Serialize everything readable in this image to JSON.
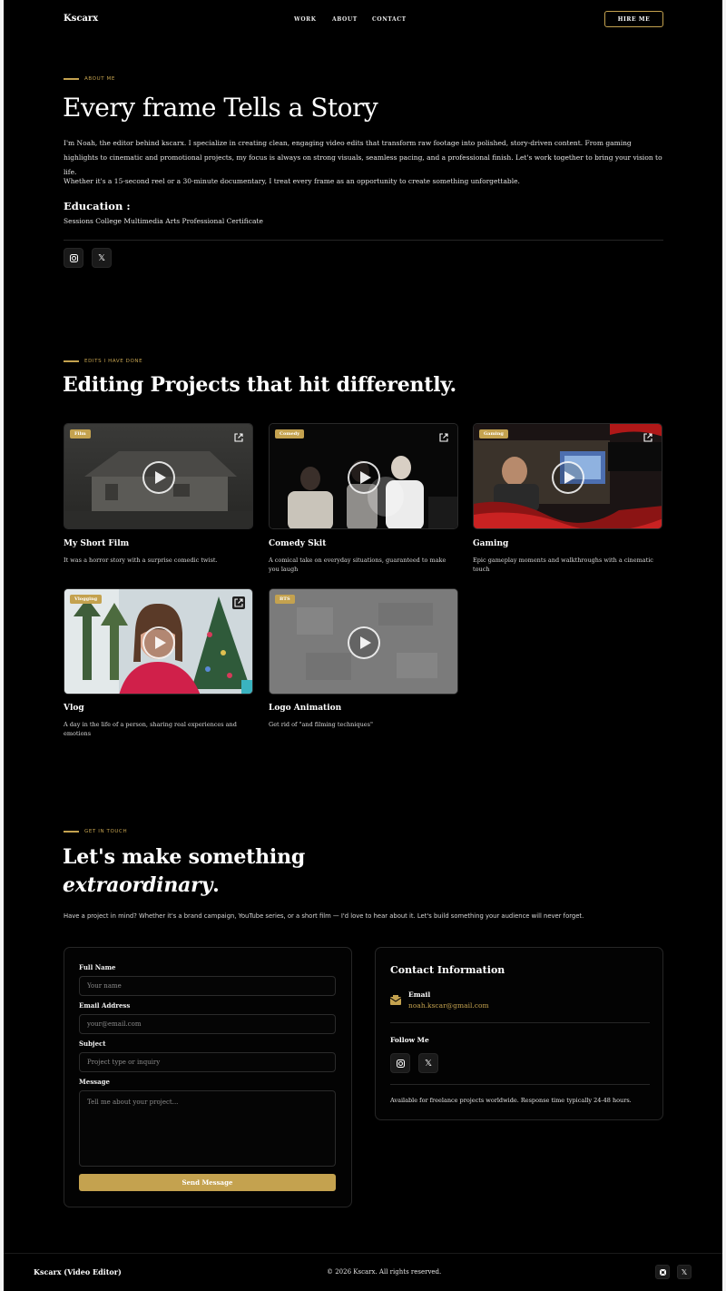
{
  "nav": {
    "logo": "Kscarx",
    "links": [
      "WORK",
      "ABOUT",
      "CONTACT"
    ],
    "cta": "HIRE ME"
  },
  "about": {
    "eyebrow": "ABOUT ME",
    "title": "Every frame Tells a Story",
    "para1": "I'm Noah, the editor behind kscarx. I specialize in creating clean, engaging video edits that transform raw footage into polished, story-driven content. From gaming highlights to cinematic and promotional projects, my focus is always on strong visuals, seamless pacing, and a professional finish. Let's work together to bring your vision to life.",
    "para2": "Whether it's a 15-second reel or a 30-minute documentary, I treat every frame as an opportunity to create something unforgettable.",
    "education_heading": "Education :",
    "education_value": "Sessions College Multimedia Arts Professional Certificate",
    "social": [
      "instagram-icon",
      "x-icon"
    ]
  },
  "projects": {
    "eyebrow": "EDITS I HAVE DONE",
    "title": "Editing Projects that hit differently.",
    "items": [
      {
        "tag": "Film",
        "title": "My Short Film",
        "desc": "It was a horror story with a surprise comedic twist."
      },
      {
        "tag": "Comedy",
        "title": "Comedy Skit",
        "desc": "A comical take on everyday situations, guaranteed to make you laugh"
      },
      {
        "tag": "Gaming",
        "title": "Gaming",
        "desc": "Epic gameplay moments and walkthroughs with a cinematic touch"
      },
      {
        "tag": "Vlogging",
        "title": "Vlog",
        "desc": "A day in the life of a person, sharing real experiences and emotions"
      },
      {
        "tag": "BTS",
        "title": "Logo Animation",
        "desc": "Get rid of \"and filming techniques\""
      }
    ]
  },
  "contact": {
    "eyebrow": "GET IN TOUCH",
    "title_line1": "Let's make something",
    "title_line2_em": "extraordinary",
    "title_line2_dot": ".",
    "intro": "Have a project in mind? Whether it's a brand campaign, YouTube series, or a short film — I'd love to hear about it. Let's build something your audience will never forget.",
    "form": {
      "name_label": "Full Name",
      "name_placeholder": "Your name",
      "email_label": "Email Address",
      "email_placeholder": "your@email.com",
      "subject_label": "Subject",
      "subject_placeholder": "Project type or inquiry",
      "message_label": "Message",
      "message_placeholder": "Tell me about your project...",
      "submit": "Send Message"
    },
    "info": {
      "heading": "Contact Information",
      "email_label": "Email",
      "email_value": "noah.kscar@gmail.com",
      "follow_label": "Follow Me",
      "availability": "Available for freelance projects worldwide. Response time typically 24-48 hours."
    }
  },
  "footer": {
    "brand": "Kscarx (Video Editor)",
    "copyright": "© 2026 Kscarx. All rights reserved."
  },
  "colors": {
    "background": "#000000",
    "accent_gold": "#c4a24f",
    "text": "#ffffff"
  }
}
